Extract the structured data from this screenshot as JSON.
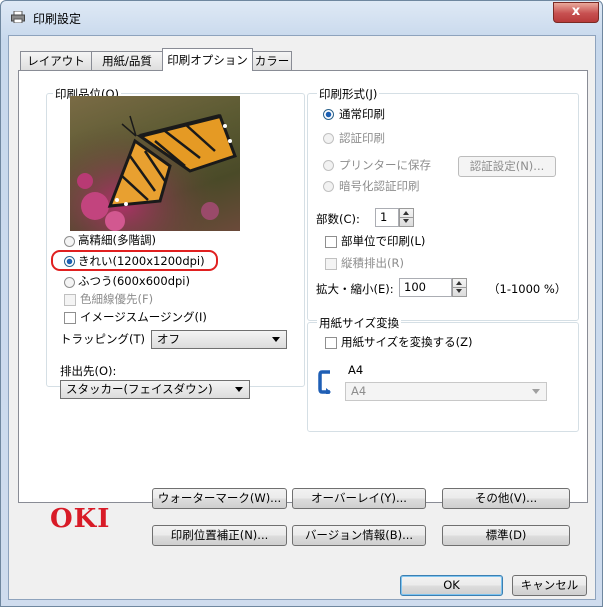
{
  "window": {
    "title": "印刷設定",
    "close_label": "x"
  },
  "tabs": [
    {
      "label": "レイアウト",
      "active": false
    },
    {
      "label": "用紙/品質",
      "active": false
    },
    {
      "label": "印刷オプション",
      "active": true
    },
    {
      "label": "カラー",
      "active": false
    }
  ],
  "print_quality": {
    "label": "印刷品位(Q)",
    "options": [
      {
        "label": "高精細(多階調)",
        "selected": false
      },
      {
        "label": "きれい(1200x1200dpi)",
        "selected": true
      },
      {
        "label": "ふつう(600x600dpi)",
        "selected": false
      }
    ],
    "thin_line": {
      "label": "色細線優先(F)",
      "checked": false,
      "enabled": false
    },
    "image_smoothing": {
      "label": "イメージスムージング(I)",
      "checked": false
    },
    "trapping": {
      "label": "トラッピング(T)",
      "value": "オフ"
    }
  },
  "output": {
    "label": "排出先(O):",
    "value": "スタッカー(フェイスダウン)"
  },
  "print_format": {
    "label": "印刷形式(J)",
    "options": [
      {
        "label": "通常印刷",
        "selected": true,
        "enabled": true
      },
      {
        "label": "認証印刷",
        "selected": false,
        "enabled": false
      },
      {
        "label": "プリンターに保存",
        "selected": false,
        "enabled": false
      },
      {
        "label": "暗号化認証印刷",
        "selected": false,
        "enabled": false
      }
    ],
    "auth_settings_label": "認証設定(N)...",
    "copies": {
      "label": "部数(C):",
      "value": "1"
    },
    "collate": {
      "label": "部単位で印刷(L)",
      "checked": false
    },
    "vertical_output": {
      "label": "縦積排出(R)",
      "checked": false,
      "enabled": false
    },
    "scale": {
      "label": "拡大・縮小(E):",
      "value": "100",
      "range": "（1-1000 %）"
    }
  },
  "paper_size_convert": {
    "label": "用紙サイズ変換",
    "convert": {
      "label": "用紙サイズを変換する(Z)",
      "checked": false
    },
    "source_size": "A4",
    "target_size": "A4"
  },
  "buttons": {
    "watermark": "ウォーターマーク(W)...",
    "overlay": "オーバーレイ(Y)...",
    "other": "その他(V)...",
    "position_adjust": "印刷位置補正(N)...",
    "version_info": "バージョン情報(B)...",
    "standard": "標準(D)",
    "ok": "OK",
    "cancel": "キャンセル"
  },
  "brand": {
    "logo": "OKI",
    "color": "#d81b27"
  },
  "colors": {
    "accent": "#3c7fb1",
    "highlight": "#e02020"
  }
}
